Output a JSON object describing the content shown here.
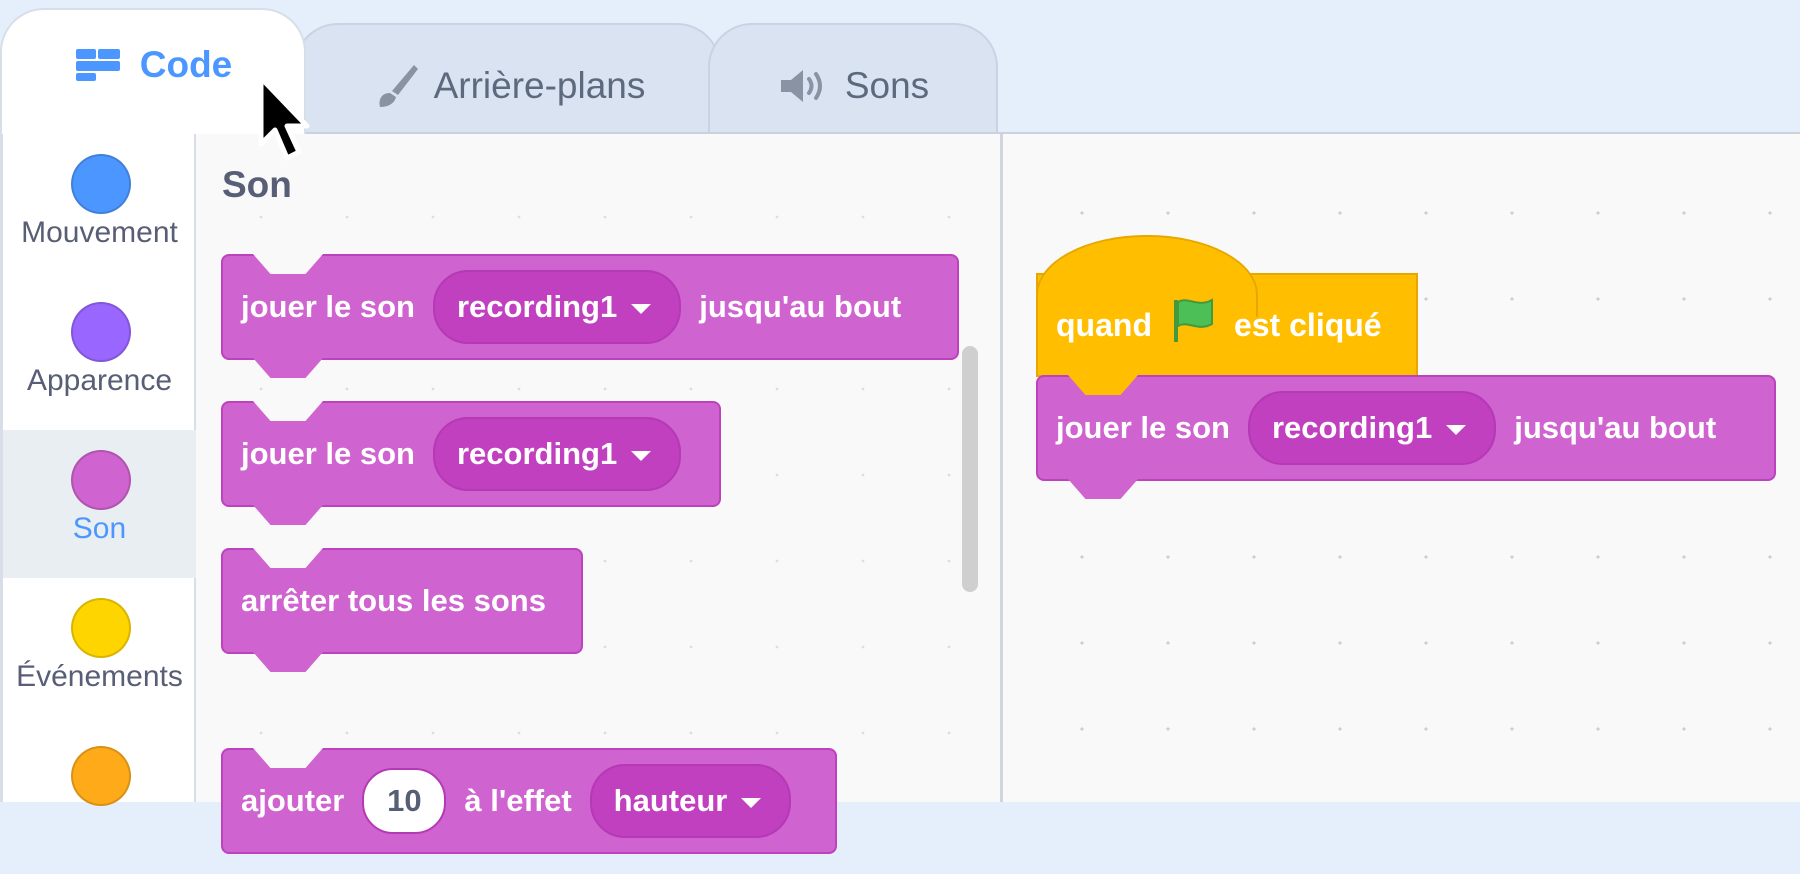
{
  "tabs": [
    {
      "label": "Code",
      "icon": "code-icon",
      "active": true
    },
    {
      "label": "Arrière-plans",
      "icon": "brush-icon",
      "active": false
    },
    {
      "label": "Sons",
      "icon": "speaker-icon",
      "active": false
    }
  ],
  "categories": [
    {
      "label": "Mouvement",
      "color": "#4c97ff"
    },
    {
      "label": "Apparence",
      "color": "#9966ff"
    },
    {
      "label": "Son",
      "color": "#cf63cf",
      "selected": true
    },
    {
      "label": "Événements",
      "color": "#ffd500"
    },
    {
      "label": "",
      "color": "#ffab19"
    }
  ],
  "palette": {
    "title": "Son",
    "blocks": {
      "play_until_done": {
        "prefix": "jouer le son",
        "sound": "recording1",
        "suffix": "jusqu'au bout"
      },
      "play": {
        "prefix": "jouer le son",
        "sound": "recording1"
      },
      "stop_all": {
        "label": "arrêter tous les sons"
      },
      "change_effect": {
        "prefix": "ajouter",
        "value": "10",
        "middle": "à l'effet",
        "effect": "hauteur"
      }
    }
  },
  "workspace": {
    "hat": {
      "prefix": "quand",
      "suffix": "est cliqué",
      "icon": "green-flag-icon"
    },
    "play_block": {
      "prefix": "jouer le son",
      "sound": "recording1",
      "suffix": "jusqu'au bout"
    }
  },
  "colors": {
    "sound_block": "#cf63cf",
    "events_block": "#ffbf00",
    "accent": "#4c97ff"
  }
}
